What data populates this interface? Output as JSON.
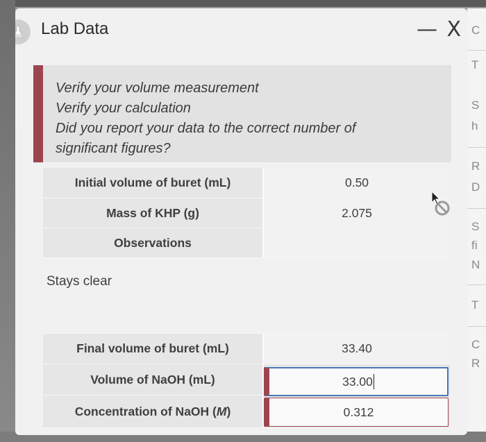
{
  "window": {
    "title": "Lab Data",
    "controls": "— X"
  },
  "callout": {
    "lines": [
      "Verify your volume measurement",
      "Verify your calculation",
      "Did you report your data to the correct number of",
      "significant figures?"
    ]
  },
  "table": {
    "initial_volume": {
      "label": "Initial volume of buret (mL)",
      "value": "0.50"
    },
    "mass_khp": {
      "label": "Mass of KHP (g)",
      "value": "2.075"
    },
    "observations": {
      "label": "Observations",
      "value": "Stays clear"
    },
    "final_volume": {
      "label": "Final volume of buret (mL)",
      "value": "33.40"
    },
    "volume_naoh": {
      "label": "Volume of NaOH (mL)",
      "value": "33.00"
    },
    "concentration_naoh": {
      "label_prefix": "Concentration of NaOH (",
      "label_unit": "M",
      "label_suffix": ")",
      "value": "0.312"
    }
  },
  "right_panel": {
    "letters": [
      "C",
      "T",
      "S",
      "h",
      "R",
      "D",
      "S",
      "fi",
      "N",
      "T",
      "C",
      "R"
    ]
  },
  "colors": {
    "accent_error": "#9c4550",
    "focus_border": "#4a76b8"
  },
  "icons": {
    "app": "flask-icon",
    "cursor": "not-allowed-cursor-icon"
  }
}
